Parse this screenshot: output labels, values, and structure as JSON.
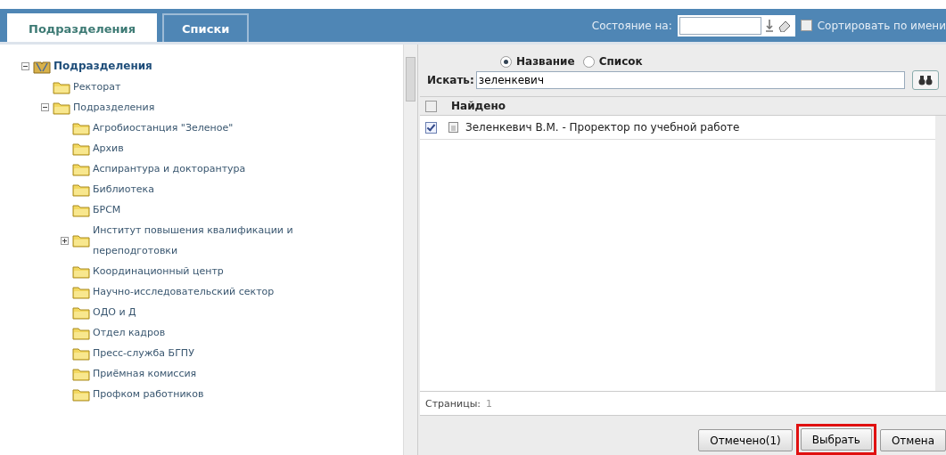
{
  "tabs": [
    {
      "label": "Подразделения",
      "selected": true
    },
    {
      "label": "Списки",
      "selected": false
    }
  ],
  "toolbar": {
    "date_label": "Состояние на:",
    "sort_label": "Сортировать по имени",
    "sort_checked": false
  },
  "tree": [
    {
      "label": "Подразделения",
      "kind": "root",
      "expanded": true,
      "children": [
        {
          "label": "Ректорат",
          "kind": "folder"
        },
        {
          "label": "Подразделения",
          "kind": "folder",
          "expanded": true,
          "children": [
            {
              "label": "Агробиостанция \"Зеленое\"",
              "kind": "folder"
            },
            {
              "label": "Архив",
              "kind": "folder"
            },
            {
              "label": "Аспирантура и докторантура",
              "kind": "folder"
            },
            {
              "label": "Библиотека",
              "kind": "folder"
            },
            {
              "label": "БРСМ",
              "kind": "folder"
            },
            {
              "label": "Институт повышения квалификации и переподготовки",
              "kind": "folder",
              "expanded": false
            },
            {
              "label": "Координационный центр",
              "kind": "folder"
            },
            {
              "label": "Научно-исследовательский сектор",
              "kind": "folder"
            },
            {
              "label": "ОДО и Д",
              "kind": "folder"
            },
            {
              "label": "Отдел кадров",
              "kind": "folder"
            },
            {
              "label": "Пресс-служба БГПУ",
              "kind": "folder"
            },
            {
              "label": "Приёмная комиссия",
              "kind": "folder"
            },
            {
              "label": "Профком работников",
              "kind": "folder"
            }
          ]
        }
      ]
    }
  ],
  "search": {
    "modes": [
      {
        "label": "Название",
        "selected": true
      },
      {
        "label": "Список",
        "selected": false
      }
    ],
    "label": "Искать:",
    "value": "зеленкевич"
  },
  "results": {
    "column": "Найдено",
    "all_checked": false,
    "rows": [
      {
        "text": "Зеленкевич В.М. - Проректор по учебной работе",
        "checked": true
      }
    ]
  },
  "pages": {
    "label": "Страницы:",
    "value": "1"
  },
  "buttons": [
    {
      "label": "Отмечено(1)",
      "highlighted": false
    },
    {
      "label": "Выбрать",
      "highlighted": true
    },
    {
      "label": "Отмена",
      "highlighted": false
    }
  ]
}
